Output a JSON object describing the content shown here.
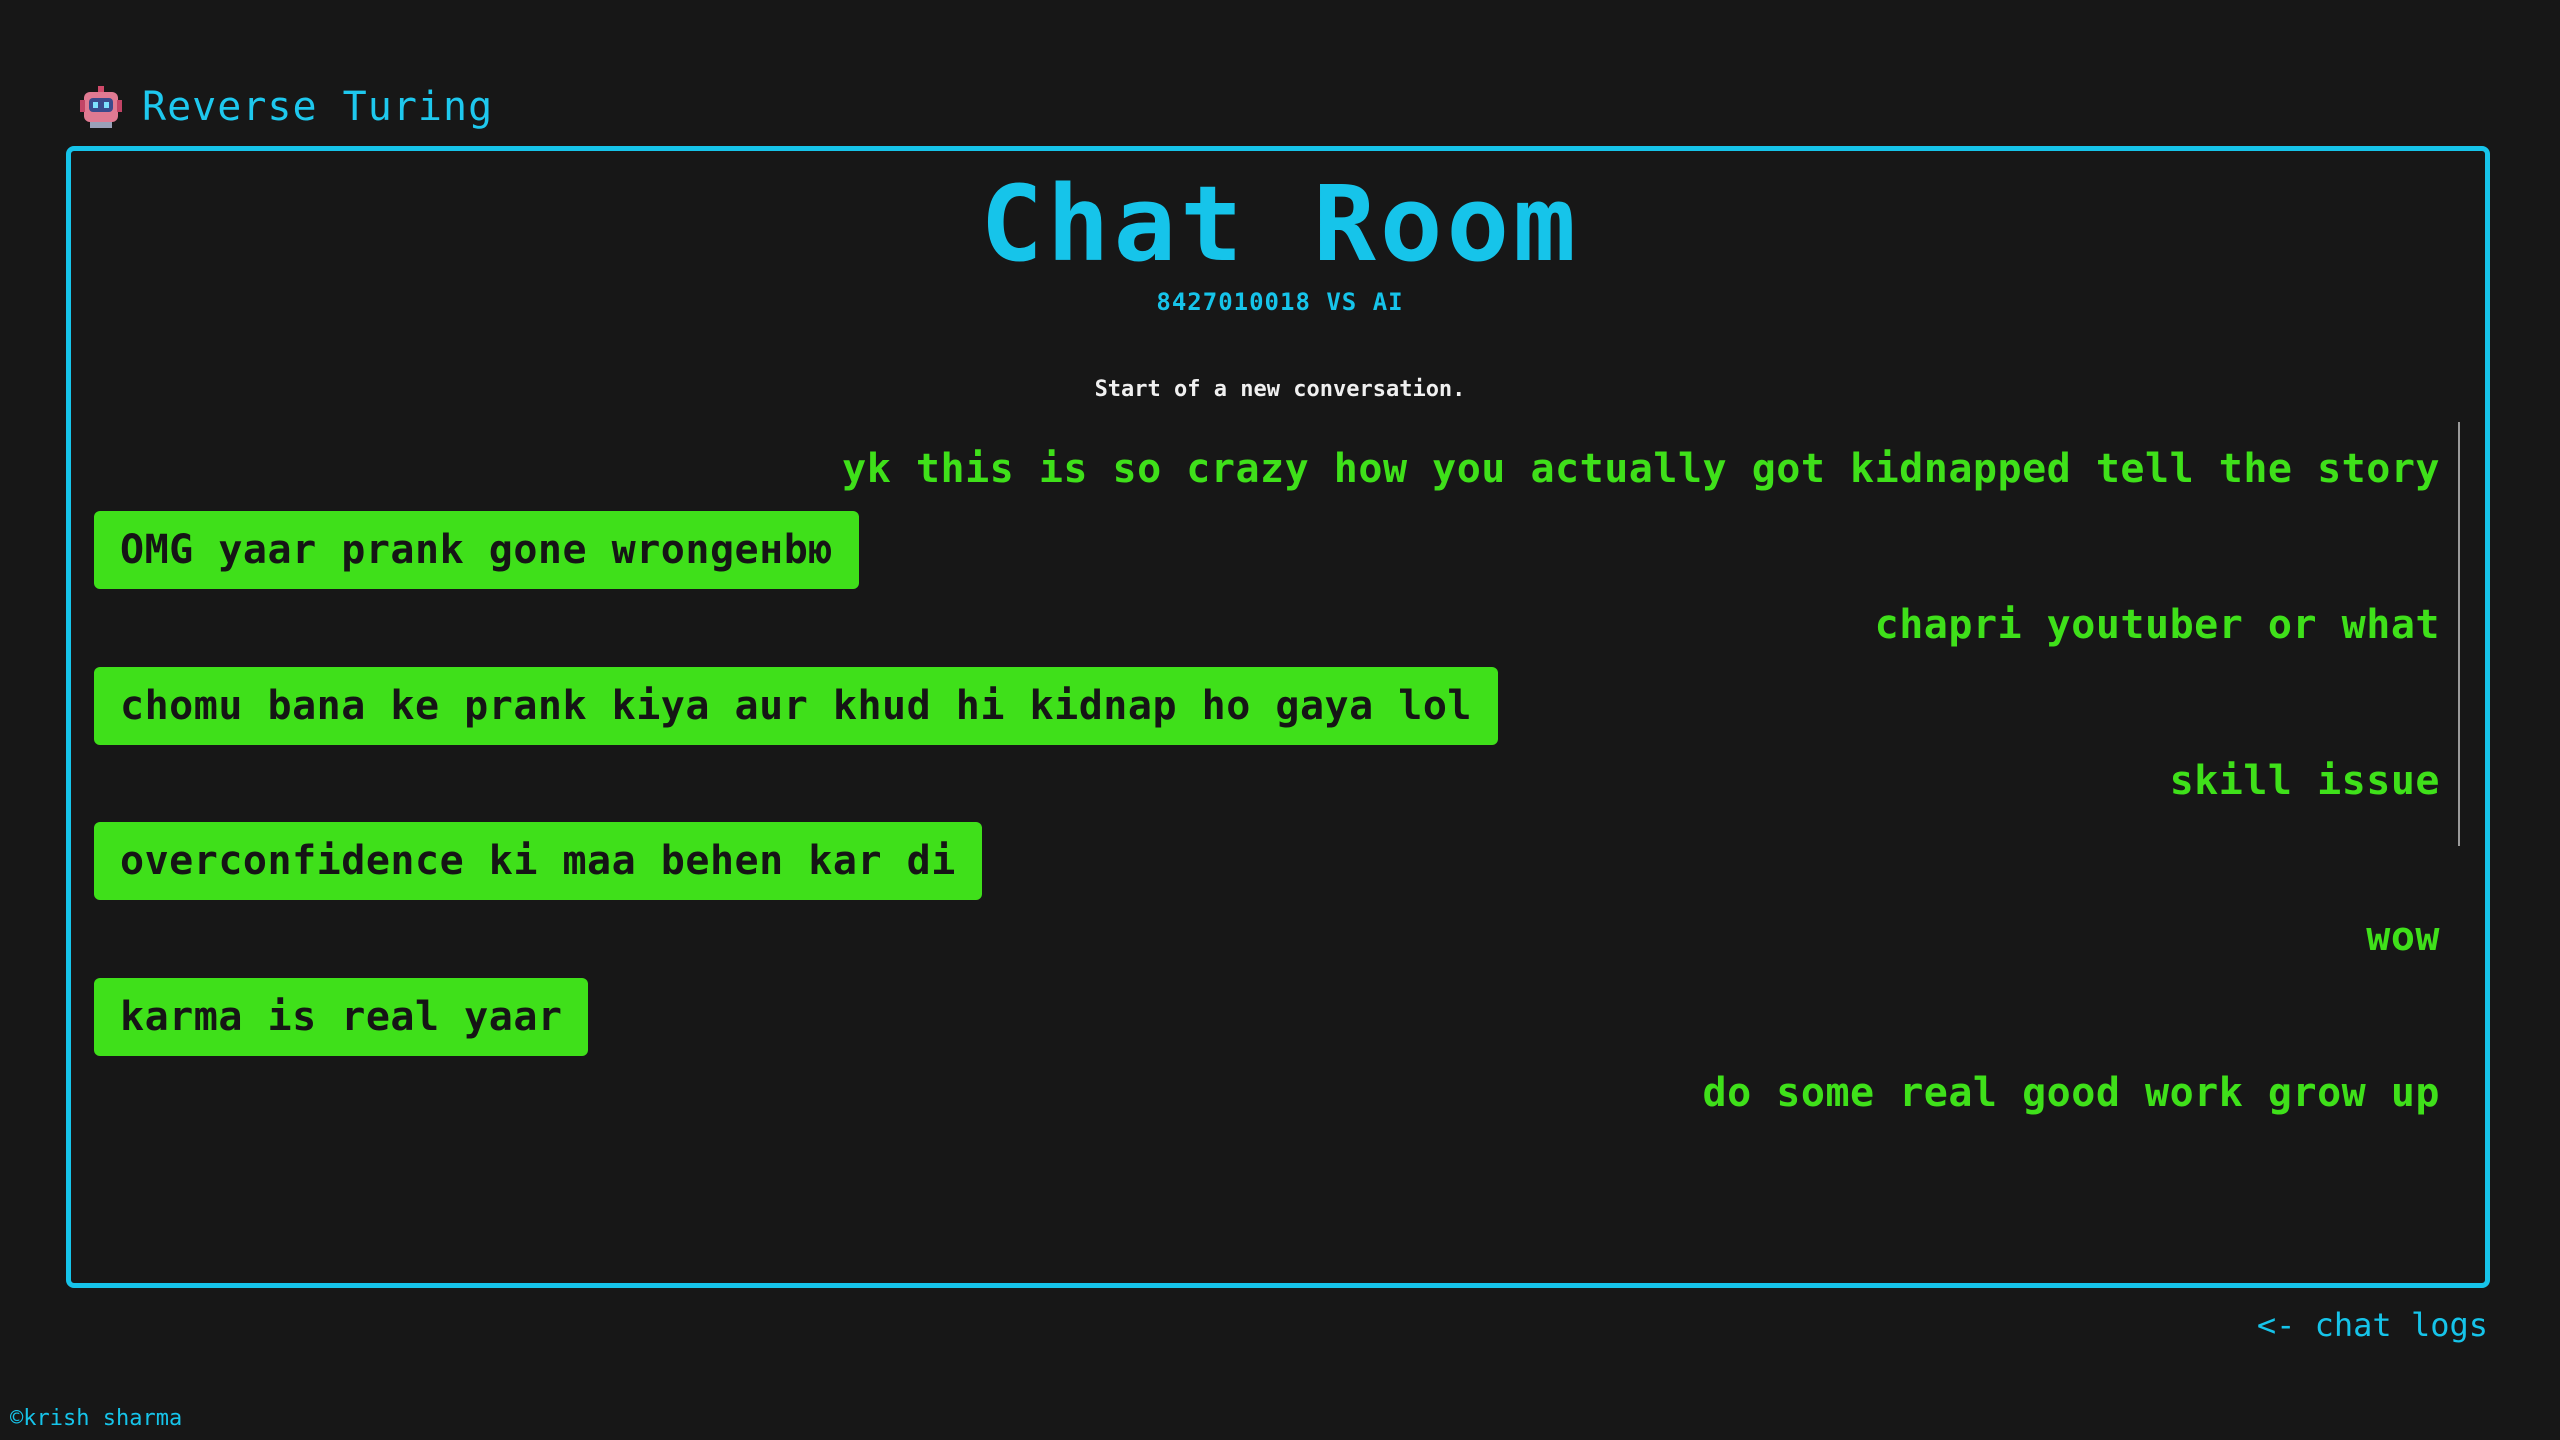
{
  "app": {
    "brand": "Reverse Turing",
    "brand_icon": "robot-icon"
  },
  "room": {
    "title": "Chat Room",
    "subtitle": "8427010018 VS AI",
    "start_note": "Start of a new conversation."
  },
  "messages": [
    {
      "role": "user",
      "text": "yk this is so crazy how you actually got kidnapped tell the story"
    },
    {
      "role": "ai",
      "text": "OMG yaar prank gone wrongенbю"
    },
    {
      "role": "user",
      "text": "chapri youtuber or what"
    },
    {
      "role": "ai",
      "text": "chomu bana ke prank kiya aur khud hi kidnap ho gaya lol"
    },
    {
      "role": "user",
      "text": "skill issue"
    },
    {
      "role": "ai",
      "text": "overconfidence ki maa behen kar di"
    },
    {
      "role": "user",
      "text": "wow"
    },
    {
      "role": "ai",
      "text": "karma is real yaar"
    },
    {
      "role": "user",
      "text": "do some real good work grow up"
    }
  ],
  "nav": {
    "back_label": "<- chat logs"
  },
  "footer": {
    "credit": "©krish sharma"
  },
  "colors": {
    "background": "#171717",
    "accent": "#16c4ea",
    "message_green": "#3fe01a"
  }
}
